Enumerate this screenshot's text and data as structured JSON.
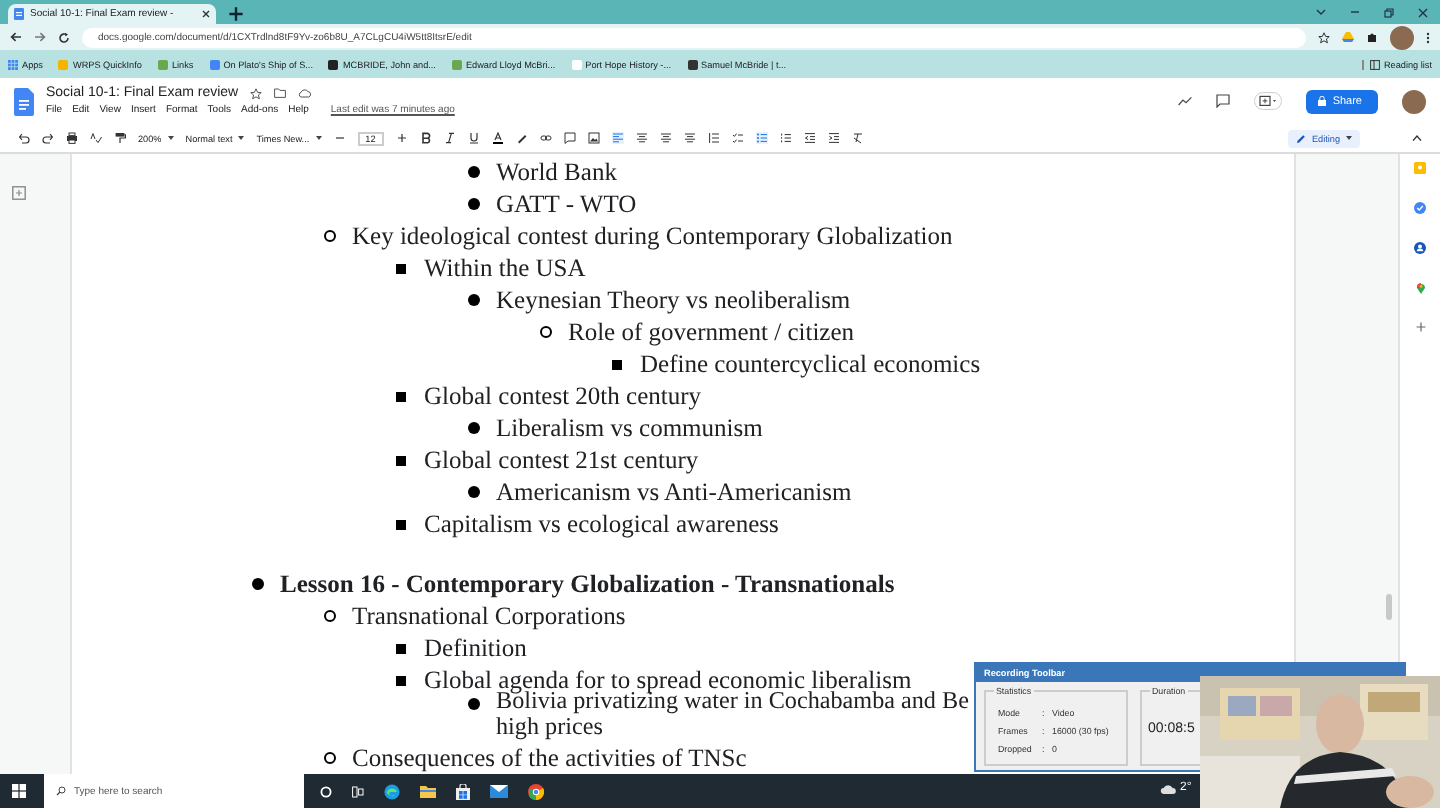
{
  "browser": {
    "tab_title": "Social 10-1: Final Exam review - ",
    "url": "docs.google.com/document/d/1CXTrdlnd8tF9Yv-zo6b8U_A7CLgCU4iW5tt8ItsrE/edit",
    "bookmarks": [
      "Apps",
      "WRPS QuickInfo",
      "Links",
      "On Plato's Ship of S...",
      "MCBRIDE, John and...",
      "Edward Lloyd McBri...",
      "Port Hope History -...",
      "Samuel McBride | t..."
    ],
    "reading_list": "Reading list"
  },
  "document": {
    "title": "Social 10-1: Final Exam review",
    "menus": [
      "File",
      "Edit",
      "View",
      "Insert",
      "Format",
      "Tools",
      "Add-ons",
      "Help"
    ],
    "last_edit": "Last edit was 7 minutes ago",
    "share": "Share"
  },
  "toolbar": {
    "zoom": "200%",
    "style": "Normal text",
    "font": "Times New...",
    "font_size": "12",
    "mode": "Editing"
  },
  "outline": [
    {
      "children": [
        {
          "children": [
            {
              "children": [
                {
                  "text": "World Bank"
                },
                {
                  "text": "GATT -  WTO"
                }
              ]
            }
          ]
        },
        {
          "text": "Key ideological contest during Contemporary Globalization",
          "children": [
            {
              "text": "Within the USA",
              "children": [
                {
                  "text": "Keynesian Theory vs neoliberalism",
                  "children": [
                    {
                      "text": "Role of government  / citizen",
                      "children": [
                        {
                          "text": "Define countercyclical economics"
                        }
                      ]
                    }
                  ]
                }
              ]
            },
            {
              "text": "Global contest 20th century",
              "children": [
                {
                  "text": "Liberalism vs communism"
                }
              ]
            },
            {
              "text": "Global contest 21st century",
              "children": [
                {
                  "text": "Americanism vs Anti-Americanism"
                }
              ]
            },
            {
              "text": "Capitalism vs ecological awareness"
            }
          ]
        }
      ]
    },
    {
      "text": "Lesson 16 - Contemporary Globalization - Transnationals",
      "bold": true,
      "children": [
        {
          "text": "Transnational Corporations",
          "children": [
            {
              "text": "Definition"
            },
            {
              "text": "Global agenda for to spread economic liberalism",
              "children": [
                {
                  "text": "Bolivia privatizing water in Cochabamba and Be",
                  "continuation": "high prices"
                }
              ]
            }
          ]
        },
        {
          "text": "Consequences of the activities of TNSc"
        }
      ]
    }
  ],
  "recording_toolbar": {
    "title": "Recording Toolbar",
    "statistics_label": "Statistics",
    "stats": [
      {
        "label": "Mode",
        "separator": ":",
        "value": "Video"
      },
      {
        "label": "Frames",
        "separator": ":",
        "value": "16000 (30 fps)"
      },
      {
        "label": "Dropped",
        "separator": ":",
        "value": "0"
      }
    ],
    "duration_label": "Duration",
    "duration": "00:08:5"
  },
  "taskbar": {
    "search_placeholder": "Type here to search",
    "temperature": "2°"
  }
}
